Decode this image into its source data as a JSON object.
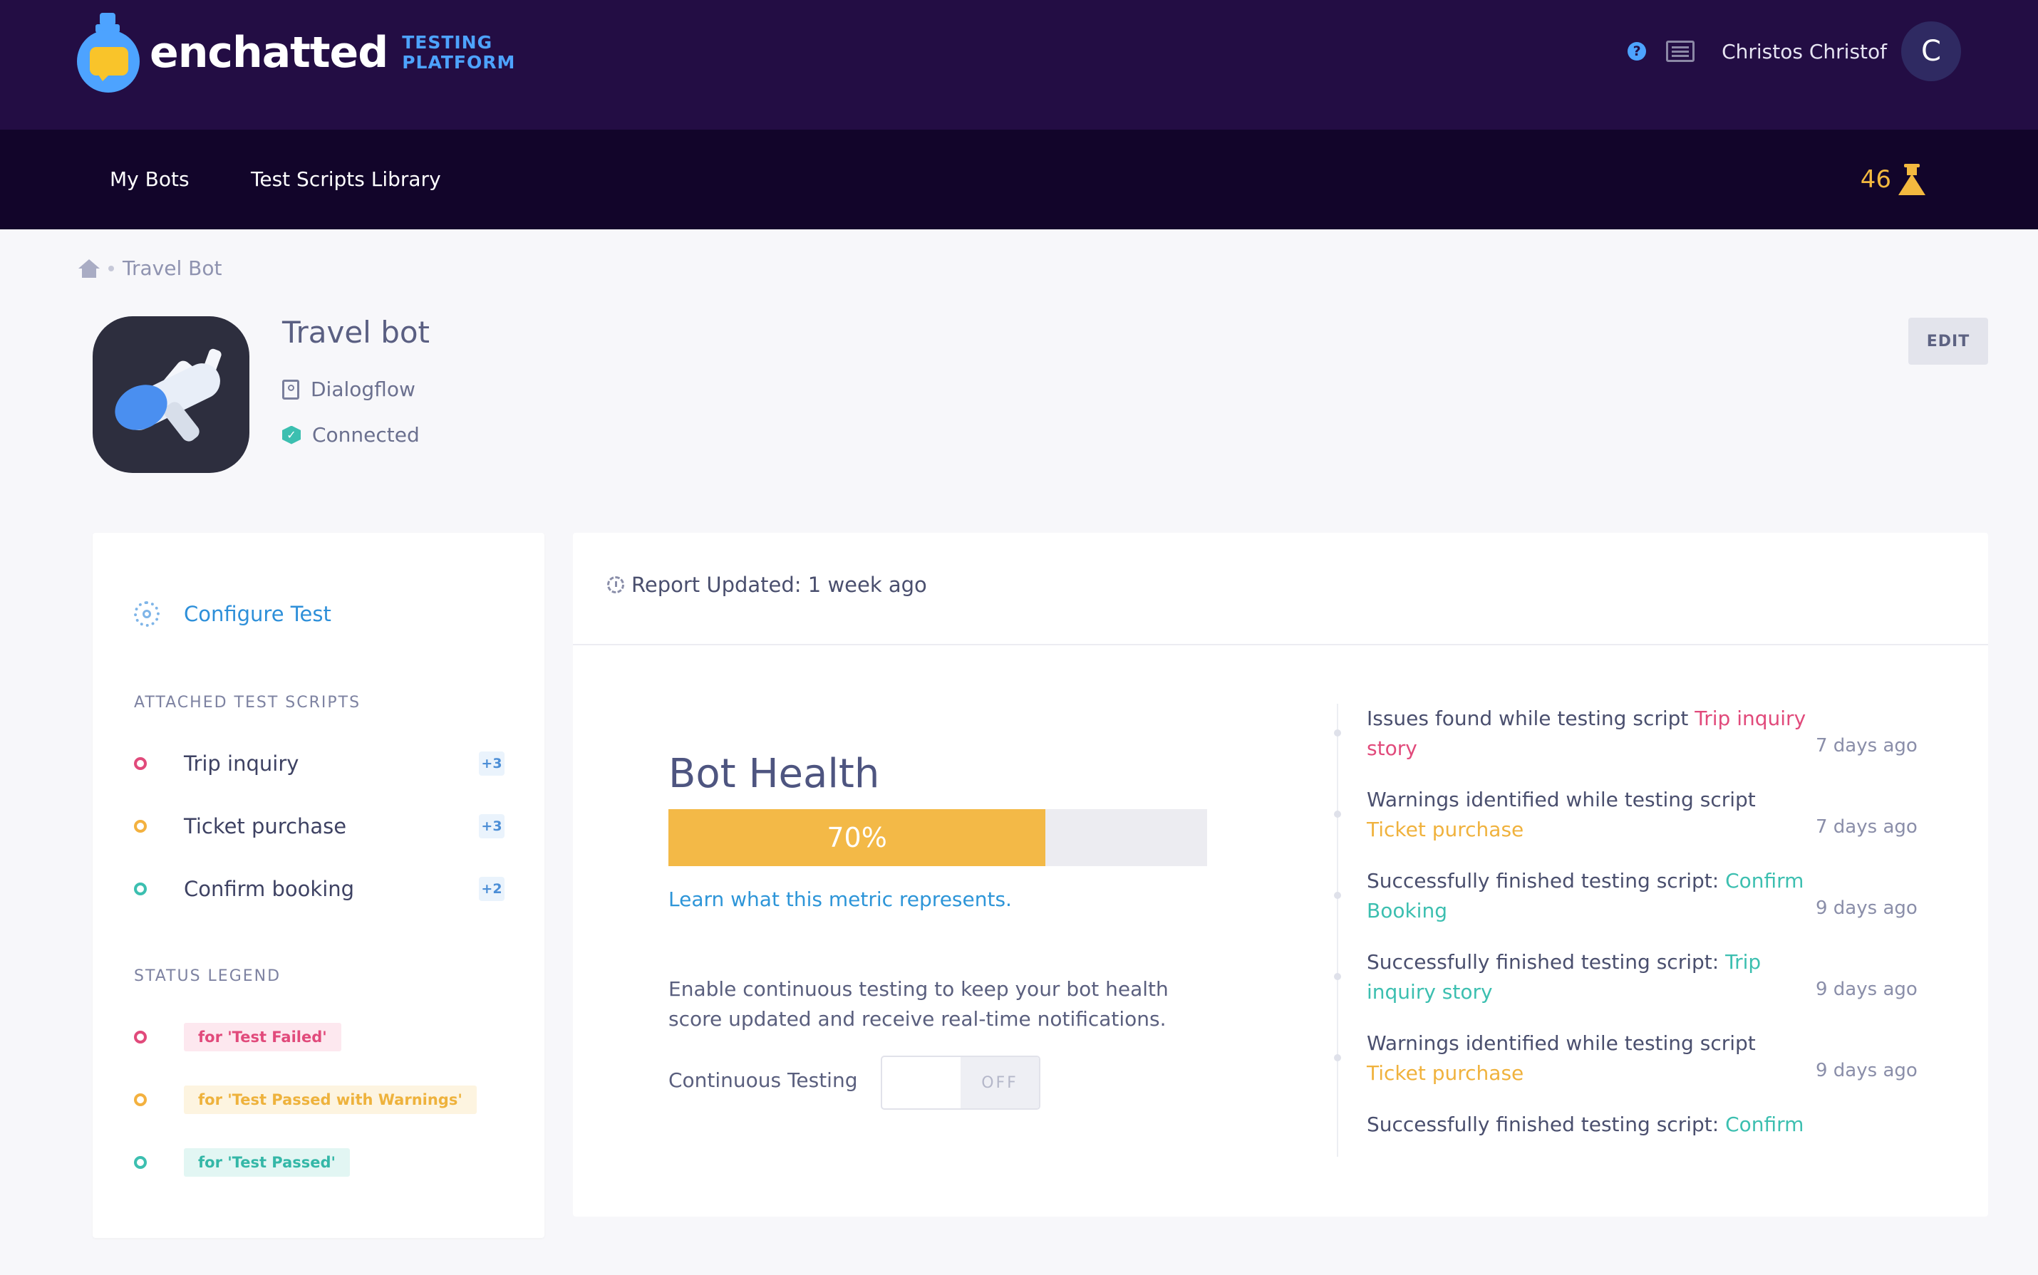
{
  "header": {
    "brand": "enchatted",
    "brand_sub_line1": "TESTING",
    "brand_sub_line2": "PLATFORM",
    "help_label": "?",
    "user_name": "Christos Christof",
    "avatar_initial": "C"
  },
  "nav": {
    "items": [
      {
        "label": "My Bots"
      },
      {
        "label": "Test Scripts Library"
      }
    ],
    "credits": "46"
  },
  "breadcrumb": {
    "current": "Travel Bot"
  },
  "bot": {
    "title": "Travel bot",
    "platform": "Dialogflow",
    "status": "Connected",
    "edit_label": "EDIT"
  },
  "sidebar": {
    "configure_label": "Configure Test",
    "attached_title": "ATTACHED TEST SCRIPTS",
    "scripts": [
      {
        "name": "Trip inquiry",
        "badge": "+3",
        "status": "fail"
      },
      {
        "name": "Ticket purchase",
        "badge": "+3",
        "status": "warn"
      },
      {
        "name": "Confirm booking",
        "badge": "+2",
        "status": "pass"
      }
    ],
    "legend_title": "STATUS LEGEND",
    "legend": [
      {
        "label": "for 'Test Failed'",
        "status": "fail"
      },
      {
        "label": "for 'Test Passed with Warnings'",
        "status": "warn"
      },
      {
        "label": "for 'Test Passed'",
        "status": "pass"
      }
    ]
  },
  "report": {
    "updated": "Report Updated: 1 week ago"
  },
  "health": {
    "title": "Bot Health",
    "percent_label": "70%",
    "percent_value": 0.7,
    "learn_link": "Learn what this metric represents.",
    "enable_text": "Enable continuous testing to keep your bot health score updated and receive real-time notifications.",
    "continuous_label": "Continuous Testing",
    "toggle_state": "OFF"
  },
  "timeline": [
    {
      "prefix": "Issues found while testing script ",
      "script": "Trip inquiry story",
      "status": "fail",
      "time": "7 days ago"
    },
    {
      "prefix": "Warnings identified while testing script ",
      "script": "Ticket purchase",
      "status": "warn",
      "time": "7 days ago"
    },
    {
      "prefix": "Successfully finished testing script: ",
      "script": "Confirm Booking",
      "status": "pass",
      "time": "9 days ago"
    },
    {
      "prefix": "Successfully finished testing script: ",
      "script": "Trip inquiry story",
      "status": "pass",
      "time": "9 days ago"
    },
    {
      "prefix": "Warnings identified while testing script ",
      "script": "Ticket purchase",
      "status": "warn",
      "time": "9 days ago"
    },
    {
      "prefix": "Successfully finished testing script: ",
      "script": "Confirm",
      "status": "pass",
      "time": ""
    }
  ],
  "colors": {
    "header_bg": "#230d44",
    "nav_bg": "#12052a",
    "accent_blue": "#2d8fd9",
    "fail": "#e14a7b",
    "warn": "#f3b13f",
    "pass": "#3cbfb0",
    "progress": "#f3b947"
  }
}
